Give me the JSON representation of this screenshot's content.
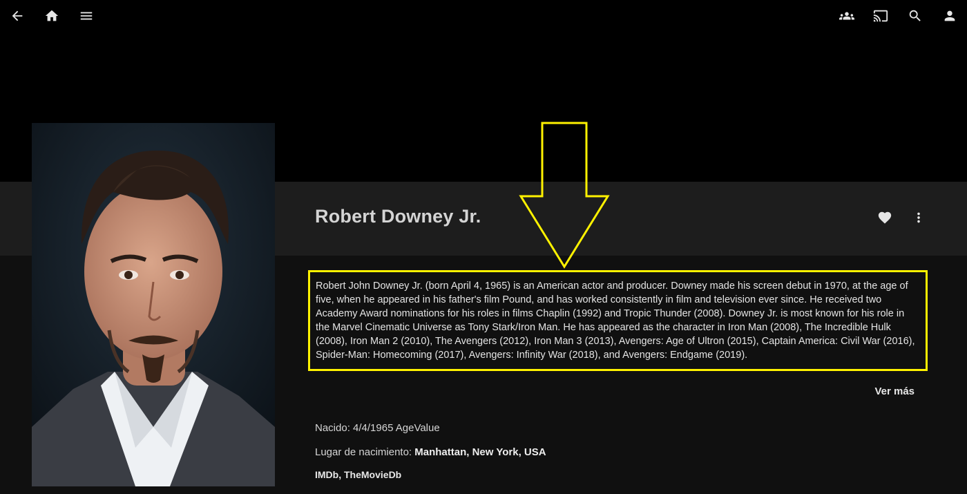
{
  "header": {
    "back_icon": "arrow-back-icon",
    "home_icon": "home-icon",
    "menu_icon": "hamburger-menu-icon",
    "sync_icon": "group-icon",
    "cast_icon": "cast-icon",
    "search_icon": "search-icon",
    "user_icon": "user-icon"
  },
  "person": {
    "name": "Robert Downey Jr.",
    "favorite_icon": "heart-icon",
    "more_icon": "more-vertical-icon",
    "overview": "Robert John Downey Jr. (born April 4, 1965) is an American actor and producer. Downey made his screen debut in 1970, at the age of five, when he appeared in his father's film Pound, and has worked consistently in film and television ever since. He received two Academy Award nominations for his roles in films Chaplin (1992) and Tropic Thunder (2008). Downey Jr. is most known for his role in the Marvel Cinematic Universe as Tony Stark/Iron Man. He has appeared as the character in Iron Man (2008), The Incredible Hulk (2008), Iron Man 2 (2010), The Avengers (2012), Iron Man 3 (2013), Avengers: Age of Ultron (2015), Captain America: Civil War (2016), Spider-Man: Homecoming (2017), Avengers: Infinity War (2018), and Avengers: Endgame (2019).",
    "more_label": "Ver más",
    "born_label": "Nacido:",
    "born_value": "4/4/1965 AgeValue",
    "birthplace_label": "Lugar de nacimiento:",
    "birthplace_value": "Manhattan, New York, USA",
    "links": [
      "IMDb",
      "TheMovieDb"
    ],
    "link_separator": ", "
  },
  "annotation": {
    "highlight_color": "#fff200"
  }
}
